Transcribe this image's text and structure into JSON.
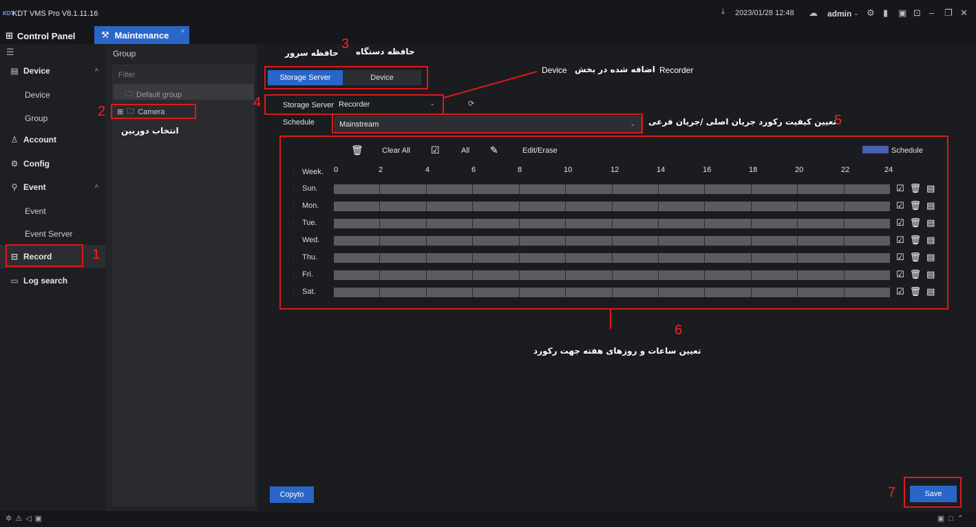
{
  "app": {
    "logo": "KDT",
    "title": "KDT VMS Pro V8.1.11.16",
    "datetime": "2023/01/28 12:48",
    "user": "admin"
  },
  "tabs": {
    "control_panel": "Control Panel",
    "maintenance": "Maintenance"
  },
  "sidebar": {
    "device": "Device",
    "device_child": "Device",
    "group": "Group",
    "account": "Account",
    "config": "Config",
    "event": "Event",
    "event_child": "Event",
    "event_server": "Event Server",
    "record": "Record",
    "log_search": "Log search"
  },
  "group_panel": {
    "title": "Group",
    "filter_placeholder": "Filter",
    "default_group": "Default group",
    "camera": "Camera"
  },
  "main": {
    "seg_storage": "Storage Server",
    "seg_device": "Device",
    "storage_label": "Storage Server",
    "storage_value": "Recorder",
    "schedule_label": "Schedule",
    "schedule_value": "Mainstream",
    "clear_all": "Clear All",
    "all": "All",
    "edit_erase": "Edit/Erase",
    "legend": "Schedule",
    "week_label": "Week.",
    "hours": [
      "0",
      "2",
      "4",
      "6",
      "8",
      "10",
      "12",
      "14",
      "16",
      "18",
      "20",
      "22",
      "24"
    ],
    "days": [
      "Sun.",
      "Mon.",
      "Tue.",
      "Wed.",
      "Thu.",
      "Fri.",
      "Sat."
    ],
    "copyto": "Copyto",
    "save": "Save"
  },
  "annotations": {
    "n1": "1",
    "n2": "2",
    "n3": "3",
    "n4": "4",
    "n5": "5",
    "n6": "6",
    "n7": "7",
    "select_camera": "انتخاب دوربین",
    "device_memory": "حافظه دستگاه",
    "server_memory": "حافظه سرور",
    "recorder_word": "Recorder",
    "added_in": "اضافه شده در بخش",
    "device_word": "Device",
    "quality": "تعیین کیفیت رکورد جریان اصلی /جریان فرعی",
    "hours_days": "تعیین ساعات و روزهای هفته جهت رکورد"
  }
}
